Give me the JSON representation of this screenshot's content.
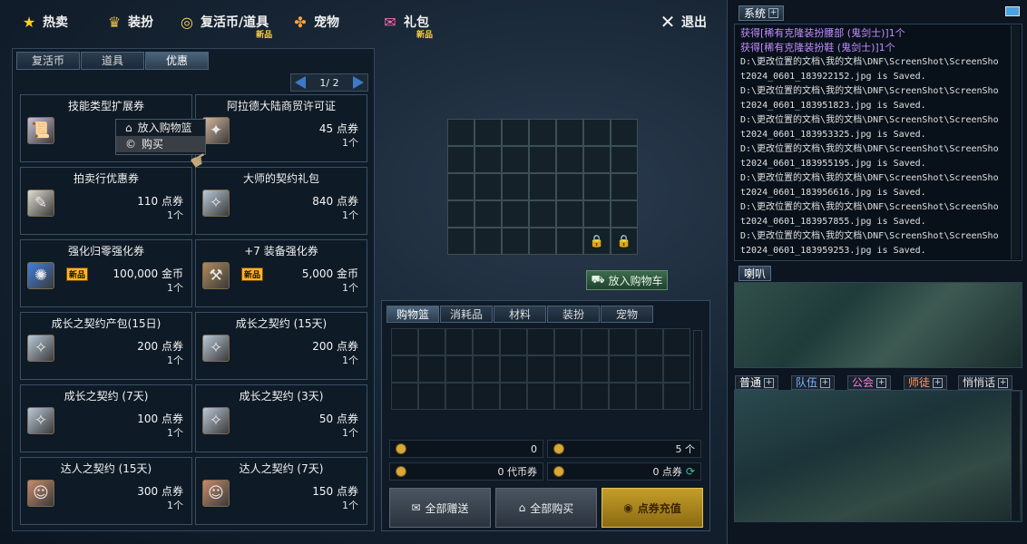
{
  "topnav": {
    "items": [
      {
        "label": "热卖",
        "icon": "star-icon",
        "new": ""
      },
      {
        "label": "装扮",
        "icon": "trophy-icon",
        "new": ""
      },
      {
        "label": "复活币/道具",
        "icon": "coin-icon",
        "new": "新品"
      },
      {
        "label": "宠物",
        "icon": "paw-icon",
        "new": ""
      },
      {
        "label": "礼包",
        "icon": "gift-icon",
        "new": "新品"
      }
    ],
    "exit_label": "退出"
  },
  "left": {
    "tabs": [
      "复活币",
      "道具",
      "优惠"
    ],
    "active_tab": 2,
    "pager": "1/ 2",
    "cards": [
      {
        "title": "技能类型扩展券",
        "price": "",
        "qty": "",
        "icon": "scroll",
        "new": false
      },
      {
        "title": "阿拉德大陆商贸许可证",
        "price": "45 点券",
        "qty": "1个",
        "icon": "certificate",
        "new": false
      },
      {
        "title": "拍卖行优惠券",
        "price": "110 点券",
        "qty": "1个",
        "icon": "ticket",
        "new": false
      },
      {
        "title": "大师的契约礼包",
        "price": "840 点券",
        "qty": "1个",
        "icon": "contract",
        "new": false
      },
      {
        "title": "强化归零强化券",
        "price": "100,000 金币",
        "qty": "1个",
        "icon": "orb",
        "new": true
      },
      {
        "title": "+7 装备强化券",
        "price": "5,000 金币",
        "qty": "1个",
        "icon": "hammer",
        "new": true
      },
      {
        "title": "成长之契约产包(15日)",
        "price": "200 点券",
        "qty": "1个",
        "icon": "contract",
        "new": false
      },
      {
        "title": "成长之契约 (15天)",
        "price": "200 点券",
        "qty": "1个",
        "icon": "contract",
        "new": false
      },
      {
        "title": "成长之契约 (7天)",
        "price": "100 点券",
        "qty": "1个",
        "icon": "contract",
        "new": false
      },
      {
        "title": "成长之契约 (3天)",
        "price": "50 点券",
        "qty": "1个",
        "icon": "contract",
        "new": false
      },
      {
        "title": "达人之契约 (15天)",
        "price": "300 点券",
        "qty": "1个",
        "icon": "portrait",
        "new": false
      },
      {
        "title": "达人之契约 (7天)",
        "price": "150 点券",
        "qty": "1个",
        "icon": "portrait",
        "new": false
      }
    ],
    "new_badge": "新品",
    "context_menu": {
      "add_to_basket": "放入购物篮",
      "buy": "购买"
    }
  },
  "center": {
    "add_to_cart": "放入购物车"
  },
  "cart": {
    "tabs": [
      "购物篮",
      "消耗品",
      "材料",
      "装扮",
      "宠物"
    ],
    "stat1_value": "0",
    "stat2_value": "5 个",
    "stat3_value": "0 代币券",
    "stat4_value": "0 点券",
    "gift_all": "全部赠送",
    "buy_all": "全部购买",
    "recharge": "点券充值"
  },
  "chat": {
    "system_tab": "系统",
    "log": [
      {
        "text": "获得[稀有克隆装扮腰部 (鬼剑士)]1个",
        "style": "purple"
      },
      {
        "text": "获得[稀有克隆装扮鞋 (鬼剑士)]1个",
        "style": "purple"
      },
      {
        "text": "D:\\更改位置的文档\\我的文档\\DNF\\ScreenShot\\ScreenSho",
        "style": "normal"
      },
      {
        "text": "t2024_0601_183922152.jpg is Saved.",
        "style": "normal"
      },
      {
        "text": "D:\\更改位置的文档\\我的文档\\DNF\\ScreenShot\\ScreenSho",
        "style": "normal"
      },
      {
        "text": "t2024_0601_183951823.jpg is Saved.",
        "style": "normal"
      },
      {
        "text": "D:\\更改位置的文档\\我的文档\\DNF\\ScreenShot\\ScreenSho",
        "style": "normal"
      },
      {
        "text": "t2024_0601_183953325.jpg is Saved.",
        "style": "normal"
      },
      {
        "text": "D:\\更改位置的文档\\我的文档\\DNF\\ScreenShot\\ScreenSho",
        "style": "normal"
      },
      {
        "text": "t2024_0601_183955195.jpg is Saved.",
        "style": "normal"
      },
      {
        "text": "D:\\更改位置的文档\\我的文档\\DNF\\ScreenShot\\ScreenSho",
        "style": "normal"
      },
      {
        "text": "t2024_0601_183956616.jpg is Saved.",
        "style": "normal"
      },
      {
        "text": "D:\\更改位置的文档\\我的文档\\DNF\\ScreenShot\\ScreenSho",
        "style": "normal"
      },
      {
        "text": "t2024_0601_183957855.jpg is Saved.",
        "style": "normal"
      },
      {
        "text": "D:\\更改位置的文档\\我的文档\\DNF\\ScreenShot\\ScreenSho",
        "style": "normal"
      },
      {
        "text": "t2024_0601_183959253.jpg is Saved.",
        "style": "normal"
      }
    ],
    "speaker_tab": "喇叭",
    "categories": [
      {
        "label": "普通",
        "color": "#ffffff"
      },
      {
        "label": "队伍",
        "color": "#7fb2ff"
      },
      {
        "label": "公会",
        "color": "#ff7ad9"
      },
      {
        "label": "师徒",
        "color": "#ff9a6a"
      },
      {
        "label": "悄悄话",
        "color": "#e0e0e0"
      }
    ]
  }
}
